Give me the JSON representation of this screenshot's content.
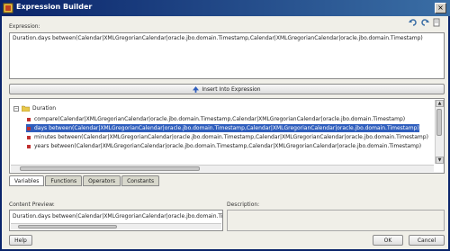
{
  "window": {
    "title": "Expression Builder",
    "close_glyph": "×"
  },
  "labels": {
    "expression": "Expression:",
    "content_preview": "Content Preview:",
    "description": "Description:"
  },
  "expression_text": "Duration.days between(Calendar|XMLGregorianCalendar|oracle.jbo.domain.Timestamp,Calendar|XMLGregorianCalendar|oracle.jbo.domain.Timestamp)",
  "insert_button": {
    "label": "Insert Into Expression"
  },
  "tree": {
    "root": {
      "toggle": "−",
      "label": "Duration"
    },
    "items": [
      {
        "label": "compare(Calendar|XMLGregorianCalendar|oracle.jbo.domain.Timestamp,Calendar|XMLGregorianCalendar|oracle.jbo.domain.Timestamp)",
        "selected": false
      },
      {
        "label": "days between(Calendar|XMLGregorianCalendar|oracle.jbo.domain.Timestamp,Calendar|XMLGregorianCalendar|oracle.jbo.domain.Timestamp)",
        "selected": true
      },
      {
        "label": "minutes between(Calendar|XMLGregorianCalendar|oracle.jbo.domain.Timestamp,Calendar|XMLGregorianCalendar|oracle.jbo.domain.Timestamp)",
        "selected": false
      },
      {
        "label": "years between(Calendar|XMLGregorianCalendar|oracle.jbo.domain.Timestamp,Calendar|XMLGregorianCalendar|oracle.jbo.domain.Timestamp)",
        "selected": false
      }
    ]
  },
  "tabs": [
    {
      "label": "Variables",
      "active": true
    },
    {
      "label": "Functions",
      "active": false
    },
    {
      "label": "Operators",
      "active": false
    },
    {
      "label": "Constants",
      "active": false
    }
  ],
  "content_preview_text": "Duration.days between(Calendar|XMLGregorianCalendar|oracle.jbo.domain.Ti",
  "buttons": {
    "help": "Help",
    "ok": "OK",
    "cancel": "Cancel"
  },
  "icons": {
    "toolbar": [
      "undo-icon",
      "redo-icon",
      "clear-icon"
    ],
    "insert": "up-arrow-icon",
    "folder": "folder-icon",
    "method": "method-icon"
  },
  "colors": {
    "title_bar": "#0a246a",
    "selection": "#2f5ebd",
    "accent": "#c03030"
  }
}
